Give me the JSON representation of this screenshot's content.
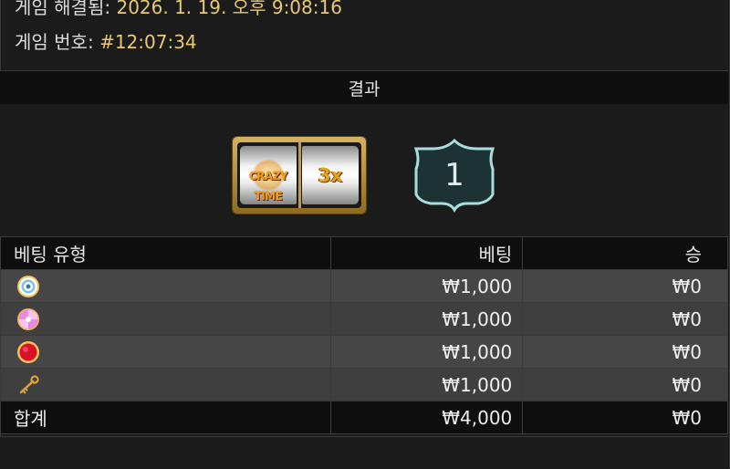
{
  "header": {
    "settled_label": "게임 해결됨:",
    "settled_value": "2026. 1. 19. 오후 9:08:16",
    "game_no_label": "게임 번호:",
    "game_no_value": "#12:07:34"
  },
  "result": {
    "title": "결과",
    "slot": {
      "left_reel": "CRAZY TIME",
      "multiplier": "3x"
    },
    "outcome": "1"
  },
  "colors": {
    "accent_gold": "#e7c873",
    "badge_teal": "#9fd9d9"
  },
  "bets_table": {
    "columns": [
      "베팅 유형",
      "베팅",
      "승"
    ],
    "rows": [
      {
        "icon": "target-icon",
        "bet": "₩1,000",
        "win": "₩0"
      },
      {
        "icon": "candy-icon",
        "bet": "₩1,000",
        "win": "₩0"
      },
      {
        "icon": "red-ball-icon",
        "bet": "₩1,000",
        "win": "₩0"
      },
      {
        "icon": "key-icon",
        "bet": "₩1,000",
        "win": "₩0"
      }
    ],
    "total": {
      "label": "합계",
      "bet": "₩4,000",
      "win": "₩0"
    }
  }
}
